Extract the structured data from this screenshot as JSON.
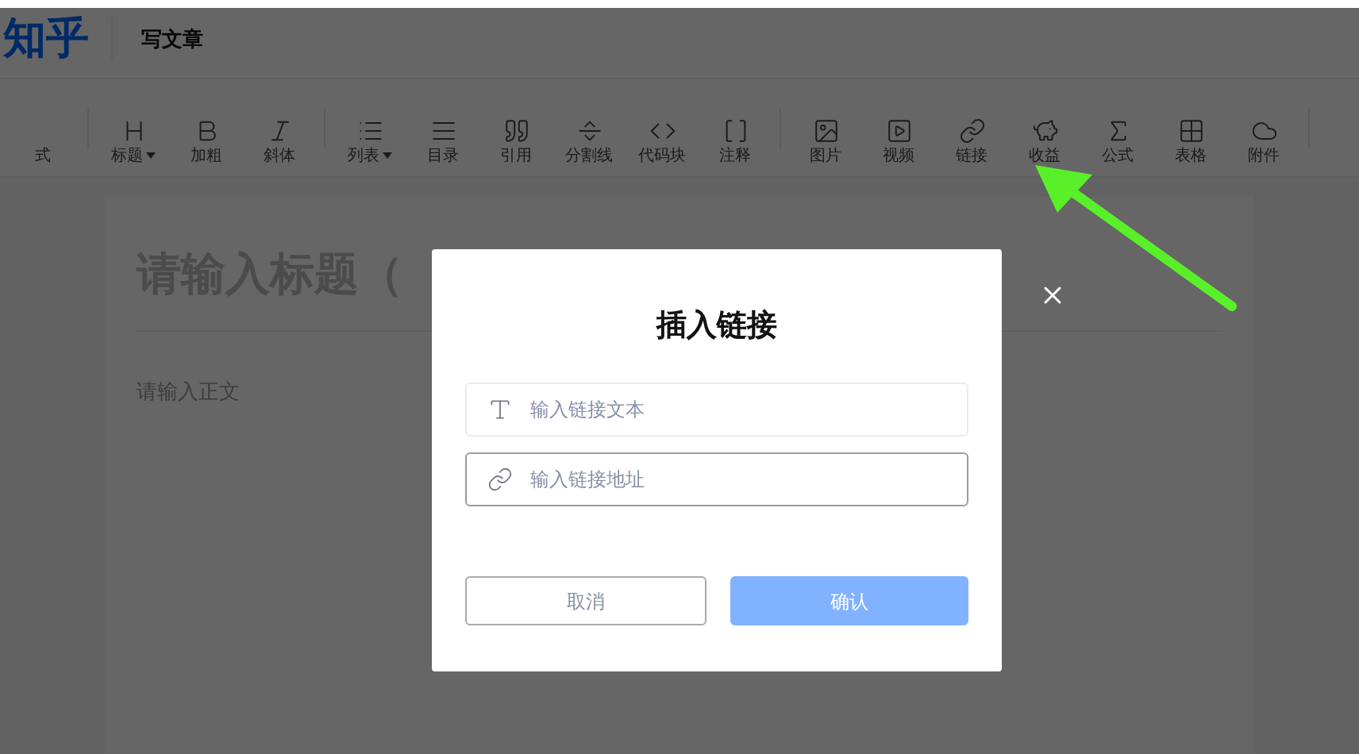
{
  "header": {
    "logo": "知乎",
    "page_title": "写文章"
  },
  "toolbar": [
    {
      "label": "式",
      "dropdown": false,
      "group_end": true
    },
    {
      "label": "标题",
      "dropdown": true,
      "group_end": false
    },
    {
      "label": "加粗",
      "dropdown": false,
      "group_end": false
    },
    {
      "label": "斜体",
      "dropdown": false,
      "group_end": true
    },
    {
      "label": "列表",
      "dropdown": true,
      "group_end": false
    },
    {
      "label": "目录",
      "dropdown": false,
      "group_end": false
    },
    {
      "label": "引用",
      "dropdown": false,
      "group_end": false
    },
    {
      "label": "分割线",
      "dropdown": false,
      "group_end": false
    },
    {
      "label": "代码块",
      "dropdown": false,
      "group_end": false
    },
    {
      "label": "注释",
      "dropdown": false,
      "group_end": true
    },
    {
      "label": "图片",
      "dropdown": false,
      "group_end": false
    },
    {
      "label": "视频",
      "dropdown": false,
      "group_end": false
    },
    {
      "label": "链接",
      "dropdown": false,
      "group_end": false
    },
    {
      "label": "收益",
      "dropdown": false,
      "group_end": false
    },
    {
      "label": "公式",
      "dropdown": false,
      "group_end": false
    },
    {
      "label": "表格",
      "dropdown": false,
      "group_end": false
    },
    {
      "label": "附件",
      "dropdown": false,
      "group_end": true
    }
  ],
  "editor": {
    "title_placeholder": "请输入标题（",
    "body_placeholder": "请输入正文"
  },
  "dialog": {
    "title": "插入链接",
    "fields": [
      {
        "kind": "text",
        "placeholder": "输入链接文本",
        "focused": false
      },
      {
        "kind": "link",
        "placeholder": "输入链接地址",
        "focused": true
      }
    ],
    "buttons": [
      {
        "label": "取消",
        "kind": "secondary",
        "disabled": false
      },
      {
        "label": "确认",
        "kind": "primary",
        "disabled": true
      }
    ]
  }
}
